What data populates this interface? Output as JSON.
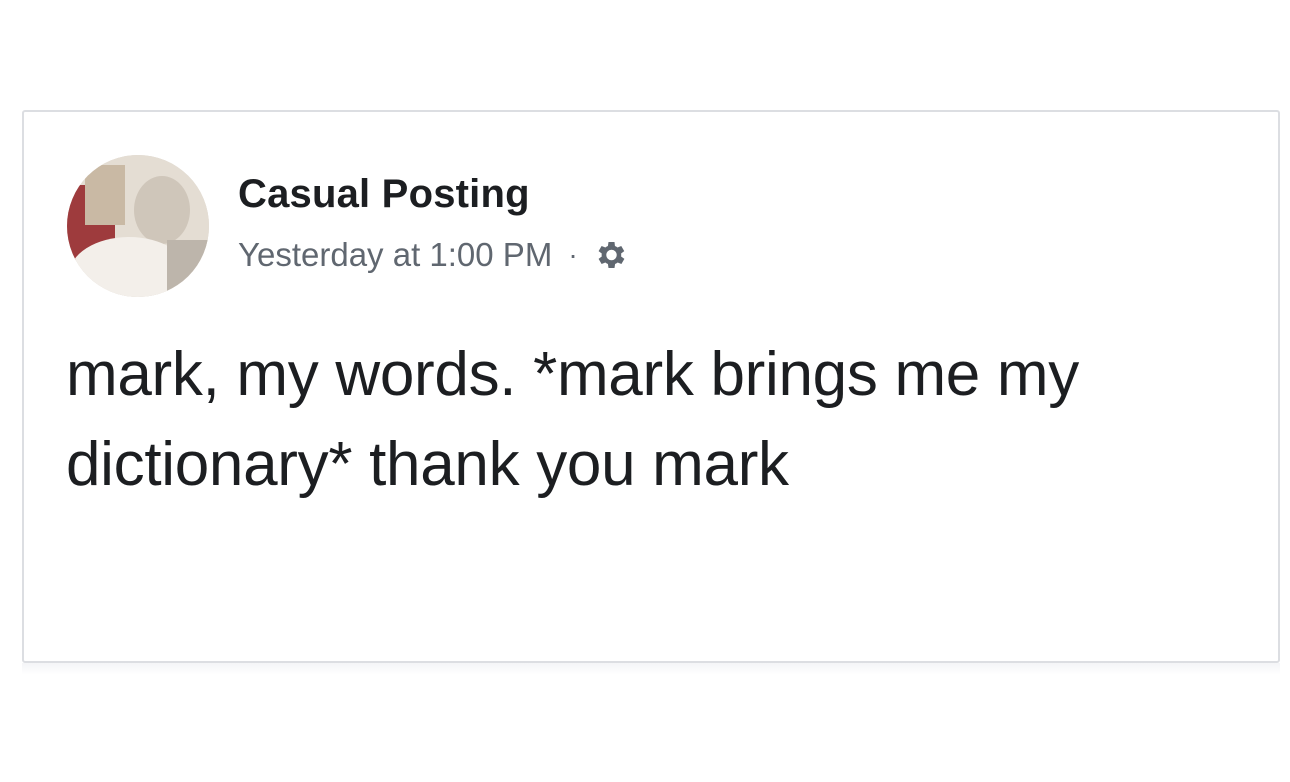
{
  "post": {
    "author": "Casual Posting",
    "timestamp": "Yesterday at 1:00 PM",
    "separator": "·",
    "audience_icon": "gear-icon",
    "text": "mark, my words. *mark brings me my dictionary* thank you mark"
  },
  "colors": {
    "author_text": "#1c1e21",
    "meta_text": "#606770",
    "border": "#dcdee2"
  }
}
